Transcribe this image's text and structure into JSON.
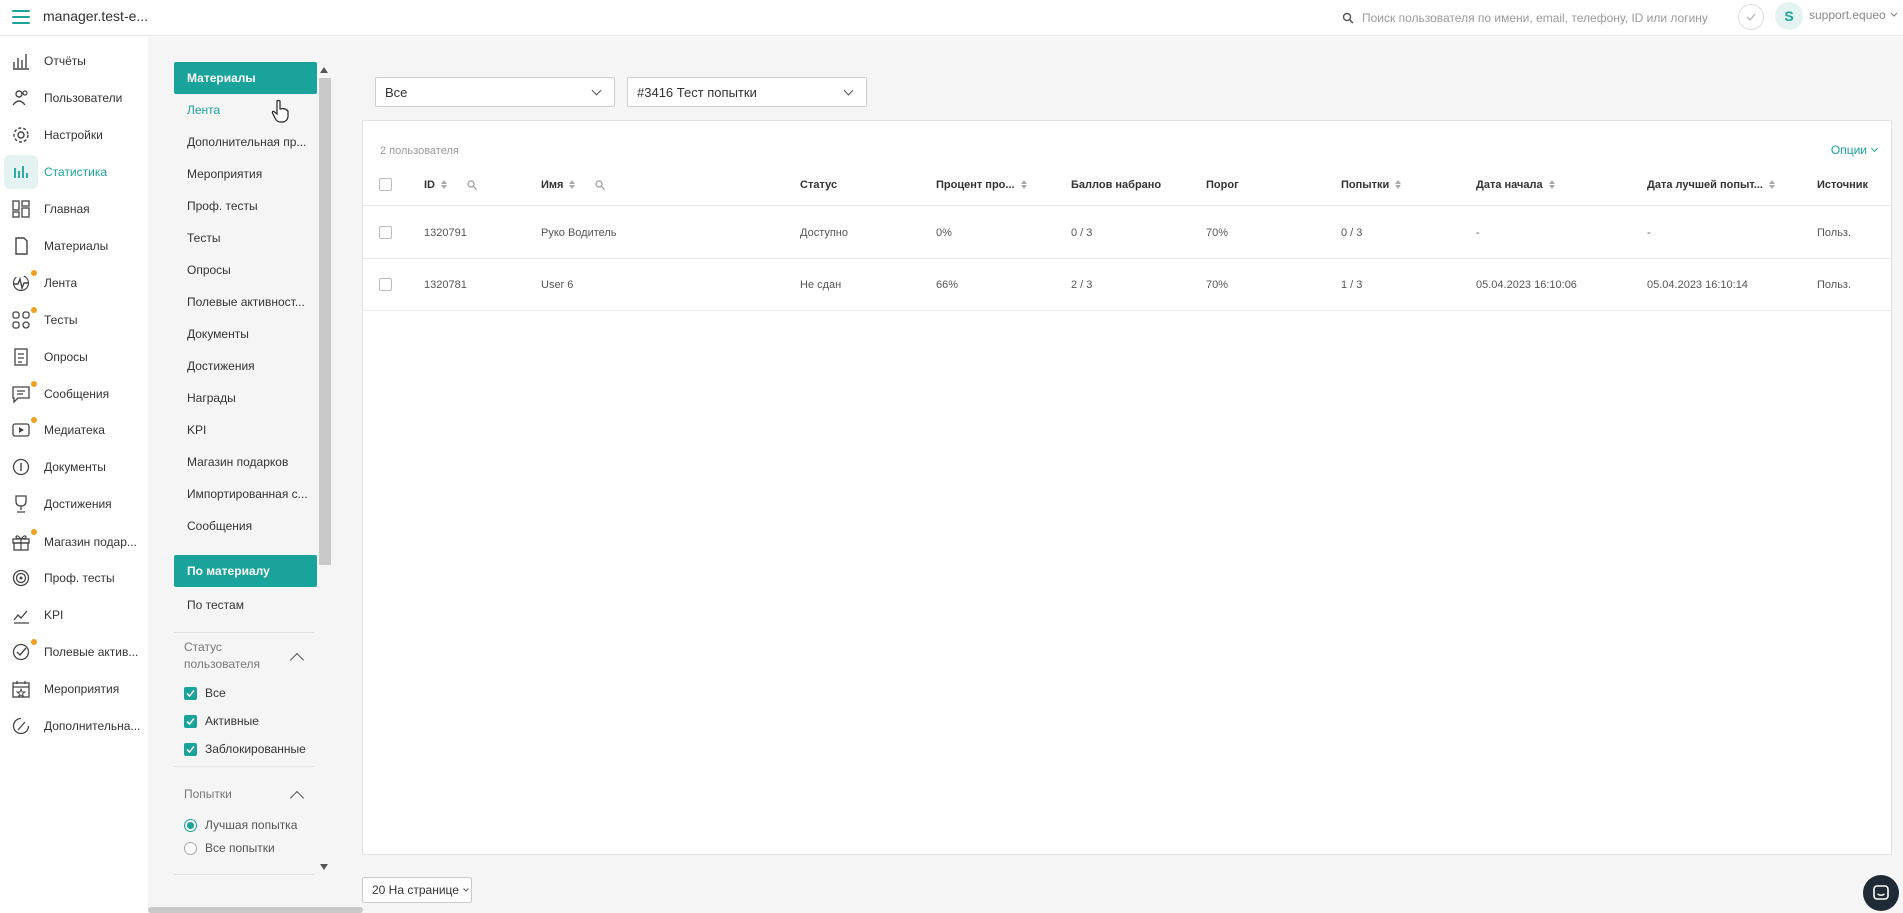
{
  "app": {
    "title": "manager.test-e..."
  },
  "search": {
    "placeholder": "Поиск пользователя по имени, email, телефону, ID или логину"
  },
  "user": {
    "initial": "S",
    "name": "support.equeo"
  },
  "colors": {
    "accent": "#1aa39a",
    "badge": "#f0a020"
  },
  "nav": [
    {
      "label": "Отчёты",
      "icon": "reports-icon",
      "dot": false,
      "active": false
    },
    {
      "label": "Пользователи",
      "icon": "users-icon",
      "dot": false,
      "active": false
    },
    {
      "label": "Настройки",
      "icon": "gear-icon",
      "dot": false,
      "active": false
    },
    {
      "label": "Статистика",
      "icon": "stats-icon",
      "dot": false,
      "active": true
    },
    {
      "label": "Главная",
      "icon": "dashboard-icon",
      "dot": false,
      "active": false
    },
    {
      "label": "Материалы",
      "icon": "materials-icon",
      "dot": false,
      "active": false
    },
    {
      "label": "Лента",
      "icon": "feed-icon",
      "dot": true,
      "active": false
    },
    {
      "label": "Тесты",
      "icon": "tests-icon",
      "dot": true,
      "active": false
    },
    {
      "label": "Опросы",
      "icon": "polls-icon",
      "dot": false,
      "active": false
    },
    {
      "label": "Сообщения",
      "icon": "messages-icon",
      "dot": true,
      "active": false
    },
    {
      "label": "Медиатека",
      "icon": "media-icon",
      "dot": true,
      "active": false
    },
    {
      "label": "Документы",
      "icon": "documents-icon",
      "dot": false,
      "active": false
    },
    {
      "label": "Достижения",
      "icon": "trophy-icon",
      "dot": false,
      "active": false
    },
    {
      "label": "Магазин подар...",
      "icon": "gift-icon",
      "dot": true,
      "active": false
    },
    {
      "label": "Проф. тесты",
      "icon": "target-icon",
      "dot": false,
      "active": false
    },
    {
      "label": "KPI",
      "icon": "kpi-icon",
      "dot": false,
      "active": false
    },
    {
      "label": "Полевые актив...",
      "icon": "field-activity-icon",
      "dot": true,
      "active": false
    },
    {
      "label": "Мероприятия",
      "icon": "events-icon",
      "dot": false,
      "active": false
    },
    {
      "label": "Дополнительна...",
      "icon": "additional-icon",
      "dot": false,
      "active": false
    }
  ],
  "subnav": {
    "section1": "Материалы",
    "items": [
      "Лента",
      "Дополнительная пр...",
      "Мероприятия",
      "Проф. тесты",
      "Тесты",
      "Опросы",
      "Полевые активност...",
      "Документы",
      "Достижения",
      "Награды",
      "KPI",
      "Магазин подарков",
      "Импортированная с...",
      "Сообщения"
    ],
    "section2": "По материалу",
    "items2": [
      "По тестам"
    ]
  },
  "filters": {
    "user_status": {
      "title": "Статус пользователя",
      "options": [
        "Все",
        "Активные",
        "Заблокированные"
      ]
    },
    "attempts": {
      "title": "Попытки",
      "options": [
        "Лучшая попытка",
        "Все попытки"
      ],
      "selected": 0
    }
  },
  "selects": {
    "scope": "Все",
    "test": "#3416 Тест попытки"
  },
  "table": {
    "count": "2 пользователя",
    "options_label": "Опции",
    "columns": [
      "ID",
      "Имя",
      "Статус",
      "Процент про...",
      "Баллов набрано",
      "Порог",
      "Попытки",
      "Дата начала",
      "Дата лучшей попыт...",
      "Источник"
    ],
    "rows": [
      [
        "1320791",
        "Руко Водитель",
        "Доступно",
        "0%",
        "0 / 3",
        "70%",
        "0 / 3",
        "-",
        "-",
        "Польз."
      ],
      [
        "1320781",
        "User 6",
        "Не сдан",
        "66%",
        "2 / 3",
        "70%",
        "1 / 3",
        "05.04.2023 16:10:06",
        "05.04.2023 16:10:14",
        "Польз."
      ]
    ]
  },
  "pagination": {
    "per_page": "20 На странице"
  }
}
